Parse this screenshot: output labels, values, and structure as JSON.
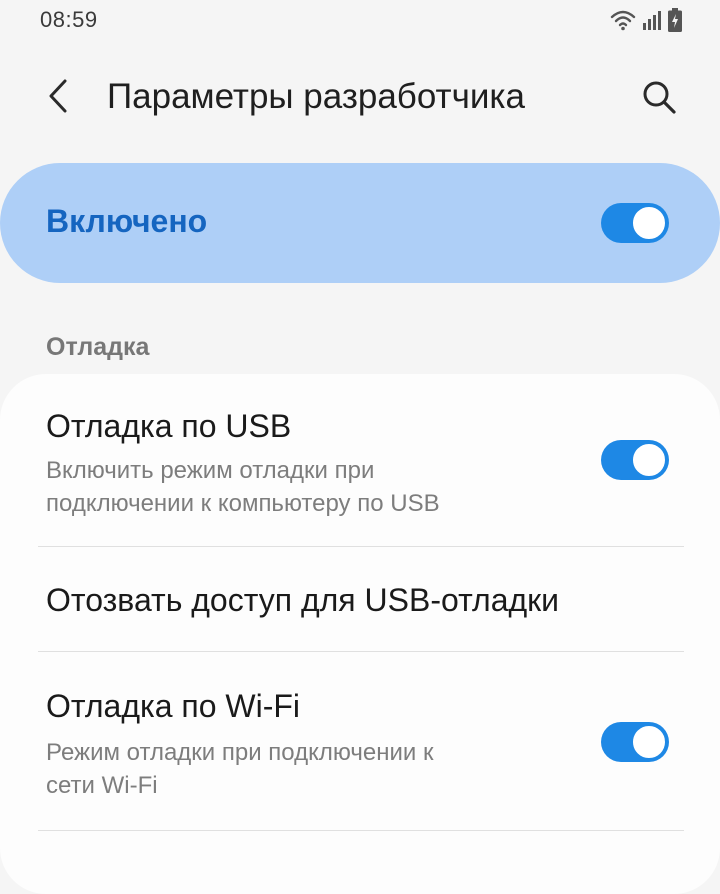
{
  "status_bar": {
    "time": "08:59",
    "icons": [
      "wifi-icon",
      "signal-icon",
      "battery-charging-icon"
    ]
  },
  "header": {
    "back_icon": "chevron-left-icon",
    "title": "Параметры разработчика",
    "search_icon": "search-icon"
  },
  "master_switch": {
    "label": "Включено",
    "state": true
  },
  "section": {
    "title": "Отладка"
  },
  "items": [
    {
      "title": "Отладка по USB",
      "subtitle_line1": "Включить режим отладки при",
      "subtitle_line2": "подключении к компьютеру по USB",
      "toggle": true
    },
    {
      "title": "Отозвать доступ для USB-отладки"
    },
    {
      "title": "Отладка по Wi-Fi",
      "subtitle_line1": "Режим отладки при подключении к",
      "subtitle_line2": "сети Wi-Fi",
      "toggle": true
    }
  ],
  "colors": {
    "accent": "#1e88e5",
    "master_bg": "#aecff7",
    "master_text": "#1565c0",
    "background": "#f5f5f5",
    "card": "#fdfdfd"
  }
}
